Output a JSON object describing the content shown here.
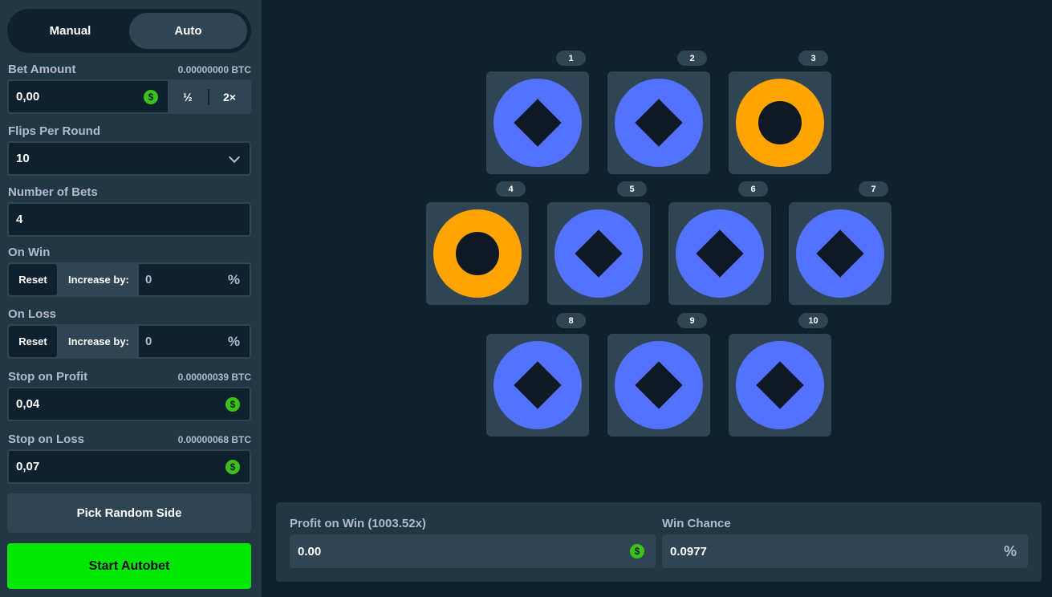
{
  "mode": {
    "manual": "Manual",
    "auto": "Auto"
  },
  "bet_amount": {
    "label": "Bet Amount",
    "btc": "0.00000000 BTC",
    "value": "0,00",
    "half": "½",
    "double": "2×"
  },
  "flips": {
    "label": "Flips Per Round",
    "value": "10"
  },
  "num_bets": {
    "label": "Number of Bets",
    "value": "4"
  },
  "on_win": {
    "label": "On Win",
    "reset": "Reset",
    "increase": "Increase by:",
    "value": "0",
    "unit": "%"
  },
  "on_loss": {
    "label": "On Loss",
    "reset": "Reset",
    "increase": "Increase by:",
    "value": "0",
    "unit": "%"
  },
  "stop_profit": {
    "label": "Stop on Profit",
    "btc": "0.00000039 BTC",
    "value": "0,04"
  },
  "stop_loss": {
    "label": "Stop on Loss",
    "btc": "0.00000068 BTC",
    "value": "0,07"
  },
  "currency_symbol": "$",
  "pick_random": "Pick Random Side",
  "start_autobet": "Start Autobet",
  "coins": [
    {
      "num": "1",
      "side": "diamond"
    },
    {
      "num": "2",
      "side": "diamond"
    },
    {
      "num": "3",
      "side": "circle"
    },
    {
      "num": "4",
      "side": "circle"
    },
    {
      "num": "5",
      "side": "diamond"
    },
    {
      "num": "6",
      "side": "diamond"
    },
    {
      "num": "7",
      "side": "diamond"
    },
    {
      "num": "8",
      "side": "diamond"
    },
    {
      "num": "9",
      "side": "diamond"
    },
    {
      "num": "10",
      "side": "diamond"
    }
  ],
  "profit": {
    "label": "Profit on Win (1003.52x)",
    "value": "0.00"
  },
  "win_chance": {
    "label": "Win Chance",
    "value": "0.0977",
    "unit": "%"
  },
  "colors": {
    "blue_side": "#5372ff",
    "orange_side": "#ffa400",
    "accent_green": "#00e701"
  }
}
